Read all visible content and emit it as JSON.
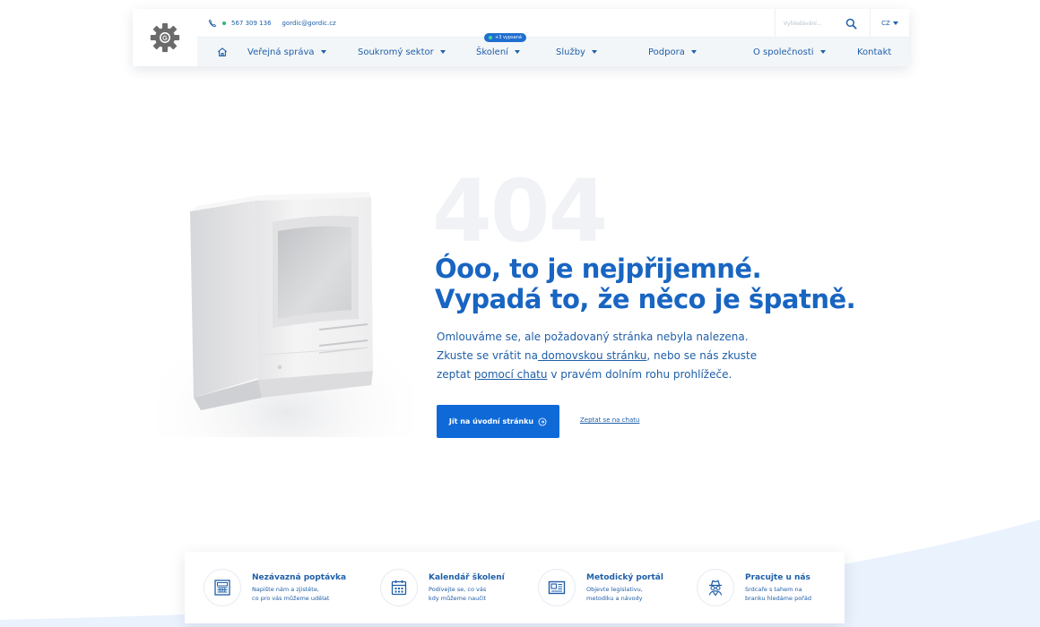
{
  "header": {
    "phone": "567 309 136",
    "email": "gordic@gordic.cz",
    "search_placeholder": "Vyhledávání...",
    "language": "CZ",
    "badge": "+3 vypsaná",
    "nav": [
      "Veřejná správa",
      "Soukromý sektor",
      "Školení",
      "Služby",
      "Podpora",
      "O společnosti",
      "Kontakt"
    ]
  },
  "hero": {
    "code": "404",
    "title_line1": "Óoo, to je nejpřijemné.",
    "title_line2": "Vypadá to, že něco je špatně.",
    "p1": "Omlouváme se, ale požadovaný stránka nebyla nalezena.",
    "p2a": "Zkuste se vrátit na",
    "p2_link": " domovskou stránku",
    "p2b": ", nebo se nás zkuste",
    "p3a": "zeptat ",
    "p3_link": "pomocí chatu",
    "p3b": " v pravém dolním rohu prohlížeče.",
    "button": "Jít na úvodní stránku",
    "chat_link": "Zeptat se na chatu"
  },
  "cards": [
    {
      "title": "Nezávazná poptávka",
      "desc1": "Napište nám a zjistěte,",
      "desc2": "co pro vás můžeme udělat",
      "icon": "calculator-icon"
    },
    {
      "title": "Kalendář školení",
      "desc1": "Podívejte se, co vás",
      "desc2": "kdy můžeme naučit",
      "icon": "calendar-icon"
    },
    {
      "title": "Metodický portál",
      "desc1": "Objevte legislativu,",
      "desc2": "metodiku a návody",
      "icon": "newspaper-icon"
    },
    {
      "title": "Pracujte u nás",
      "desc1": "Srdcaře s tahem na",
      "desc2": "branku hledáme pořád",
      "icon": "spy-icon"
    }
  ],
  "colors": {
    "primary": "#0f6ad8",
    "text": "#1f5fa8",
    "heading": "#1865c2",
    "badge": "#1f6fd1",
    "status_green": "#2bb673"
  }
}
